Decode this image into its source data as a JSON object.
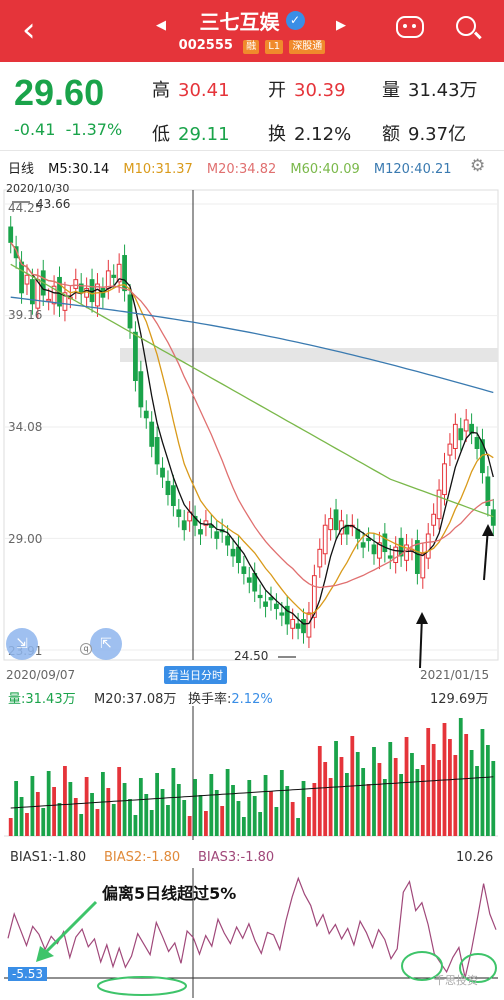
{
  "header": {
    "title": "三七互娱",
    "code": "002555",
    "tags": [
      "融",
      "L1",
      "深股通"
    ]
  },
  "quote": {
    "price": "29.60",
    "change": "-0.41",
    "change_pct": "-1.37%",
    "high_label": "高",
    "high": "30.41",
    "low_label": "低",
    "low": "29.11",
    "open_label": "开",
    "open": "30.39",
    "turnover_label": "换",
    "turnover": "2.12%",
    "volume_label": "量",
    "volume": "31.43万",
    "amount_label": "额",
    "amount": "9.37亿"
  },
  "ma_row": {
    "period": "日线",
    "ma5": "M5:30.14",
    "ma10": "M10:31.37",
    "ma20": "M20:34.82",
    "ma60": "M60:40.09",
    "ma120": "M120:40.21"
  },
  "main_chart": {
    "date_top": "2020/10/30",
    "start_date": "2020/09/07",
    "end_date": "2021/01/15",
    "timeshare_btn": "看当日分时",
    "axis_labels": [
      "44.25",
      "39.16",
      "34.08",
      "29.00",
      "23.91"
    ],
    "high_marker": "43.66",
    "low_marker": "24.50",
    "cursor_circle": "q"
  },
  "volume_panel": {
    "vol_label": "量:31.43万",
    "m20_label": "M20:37.08万",
    "turn_label": "换手率:",
    "turn_value": "2.12%",
    "max_label": "129.69万"
  },
  "bias_panel": {
    "bias1": "BIAS1:-1.80",
    "bias2": "BIAS2:-1.80",
    "bias3": "BIAS3:-1.80",
    "max_label": "10.26",
    "min_label": "-5.53",
    "annotation": "偏离5日线超过5%",
    "watermark": "千思投资"
  },
  "colors": {
    "up": "#e5343a",
    "down": "#1aa34a",
    "ma5": "#111111",
    "ma10": "#d99a1a",
    "ma20": "#e07070",
    "ma60": "#7ab84a",
    "ma120": "#3a7ab0"
  },
  "chart_data": {
    "type": "candlestick",
    "note_points": {
      "high": 43.66,
      "low": 24.5
    },
    "y_ticks": [
      44.25,
      39.16,
      34.08,
      29.0,
      23.91
    ],
    "x_range": [
      "2020/09/07",
      "2021/01/15"
    ],
    "closes": [
      42.5,
      41.8,
      40.2,
      41.0,
      39.7,
      40.8,
      40.1,
      39.9,
      40.5,
      39.6,
      40.2,
      40.0,
      40.8,
      40.2,
      40.4,
      39.8,
      40.6,
      40.0,
      41.2,
      40.9,
      41.5,
      40.3,
      38.6,
      36.2,
      35.0,
      34.5,
      33.2,
      32.4,
      31.8,
      31.0,
      30.5,
      30.0,
      29.4,
      30.2,
      29.6,
      29.2,
      29.8,
      29.5,
      29.0,
      29.3,
      28.7,
      28.2,
      27.9,
      27.4,
      27.0,
      26.6,
      26.3,
      25.9,
      26.2,
      25.8,
      25.5,
      25.1,
      25.3,
      24.9,
      24.7,
      25.6,
      27.3,
      28.5,
      29.6,
      29.9,
      29.4,
      29.8,
      29.2,
      29.6,
      29.0,
      28.6,
      28.9,
      28.3,
      28.8,
      28.4,
      28.1,
      28.6,
      28.2,
      28.7,
      28.5,
      27.4,
      28.3,
      29.2,
      30.1,
      31.2,
      32.4,
      33.3,
      34.2,
      33.5,
      34.4,
      33.8,
      33.1,
      32.0,
      30.5,
      29.6
    ],
    "bias1": [
      0.5,
      4.2,
      1.8,
      -0.6,
      2.3,
      1.1,
      -1.2,
      0.8,
      -0.3,
      1.5,
      -2.4,
      0.7,
      1.9,
      -0.8,
      0.4,
      -3.1,
      -0.5,
      -3.8,
      -1.0,
      -3.9,
      -2.2,
      1.2,
      -0.4,
      -2.0,
      2.9,
      0.8,
      -1.5,
      -0.2,
      -3.3,
      1.6,
      0.6,
      -1.9,
      0.9,
      -0.7,
      3.4,
      1.3,
      -0.3,
      2.2,
      0.5,
      2.7,
      0.1,
      -1.8,
      1.4,
      1.0,
      -1.2,
      3.2,
      6.8,
      9.6,
      7.2,
      5.5,
      2.4,
      4.1,
      1.2,
      2.6,
      0.4,
      2.0,
      -0.5,
      3.1,
      1.4,
      -0.9,
      1.8,
      0.3,
      -2.6,
      -1.1,
      7.5,
      9.1,
      4.7,
      5.9,
      2.6,
      -1.8,
      -3.2,
      -4.6,
      -2.4,
      -0.9,
      -5.5,
      -1.4,
      3.6,
      8.8,
      4.2,
      1.8
    ]
  }
}
